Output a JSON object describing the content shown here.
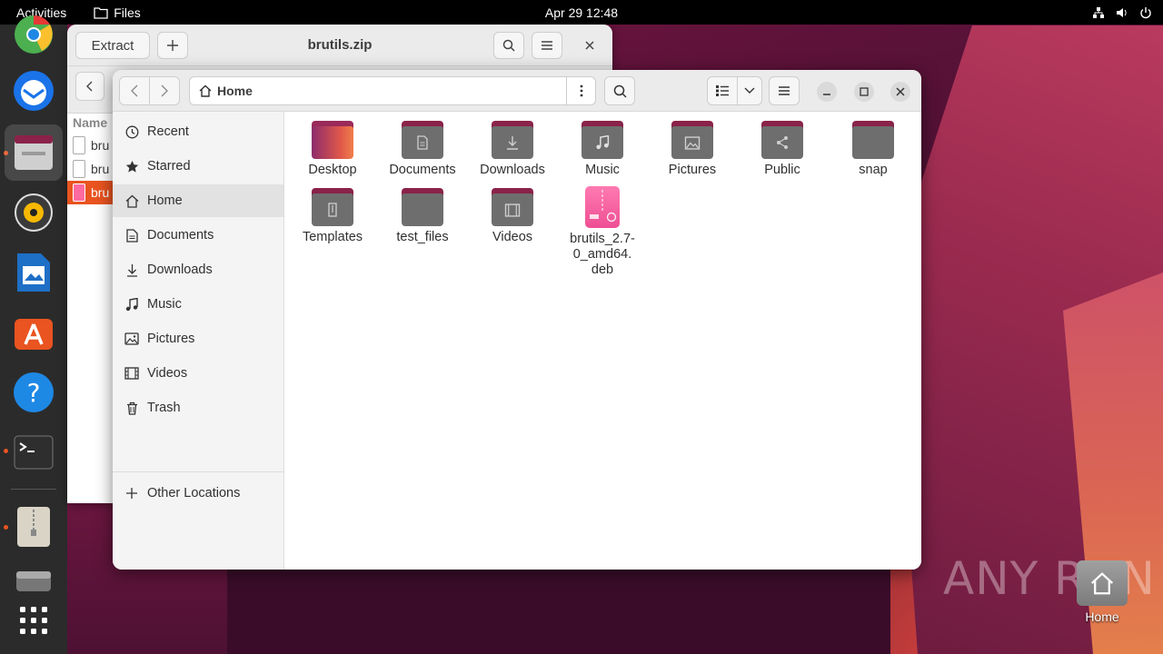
{
  "topbar": {
    "activities": "Activities",
    "app_name": "Files",
    "clock": "Apr 29  12:48"
  },
  "archive_window": {
    "extract_label": "Extract",
    "title": "brutils.zip",
    "column_name": "Name",
    "rows": [
      {
        "name": "bru"
      },
      {
        "name": "bru"
      },
      {
        "name": "bru"
      }
    ]
  },
  "files_window": {
    "path_label": "Home",
    "sidebar": {
      "items": [
        {
          "label": "Recent",
          "icon": "clock-icon"
        },
        {
          "label": "Starred",
          "icon": "star-icon"
        },
        {
          "label": "Home",
          "icon": "home-icon"
        },
        {
          "label": "Documents",
          "icon": "document-icon"
        },
        {
          "label": "Downloads",
          "icon": "download-icon"
        },
        {
          "label": "Music",
          "icon": "music-icon"
        },
        {
          "label": "Pictures",
          "icon": "picture-icon"
        },
        {
          "label": "Videos",
          "icon": "video-icon"
        },
        {
          "label": "Trash",
          "icon": "trash-icon"
        }
      ],
      "other_locations": "Other Locations"
    },
    "items": [
      {
        "label": "Desktop"
      },
      {
        "label": "Documents"
      },
      {
        "label": "Downloads"
      },
      {
        "label": "Music"
      },
      {
        "label": "Pictures"
      },
      {
        "label": "Public"
      },
      {
        "label": "snap"
      },
      {
        "label": "Templates"
      },
      {
        "label": "test_files"
      },
      {
        "label": "Videos"
      },
      {
        "label": "brutils_2.7-\n0_amd64.\ndeb"
      }
    ]
  },
  "desktop": {
    "home_label": "Home",
    "watermark": "ANY RUN"
  },
  "colors": {
    "accent": "#e95420",
    "folder_tab": "#8a2249",
    "folder_body": "#6e6e6e"
  }
}
